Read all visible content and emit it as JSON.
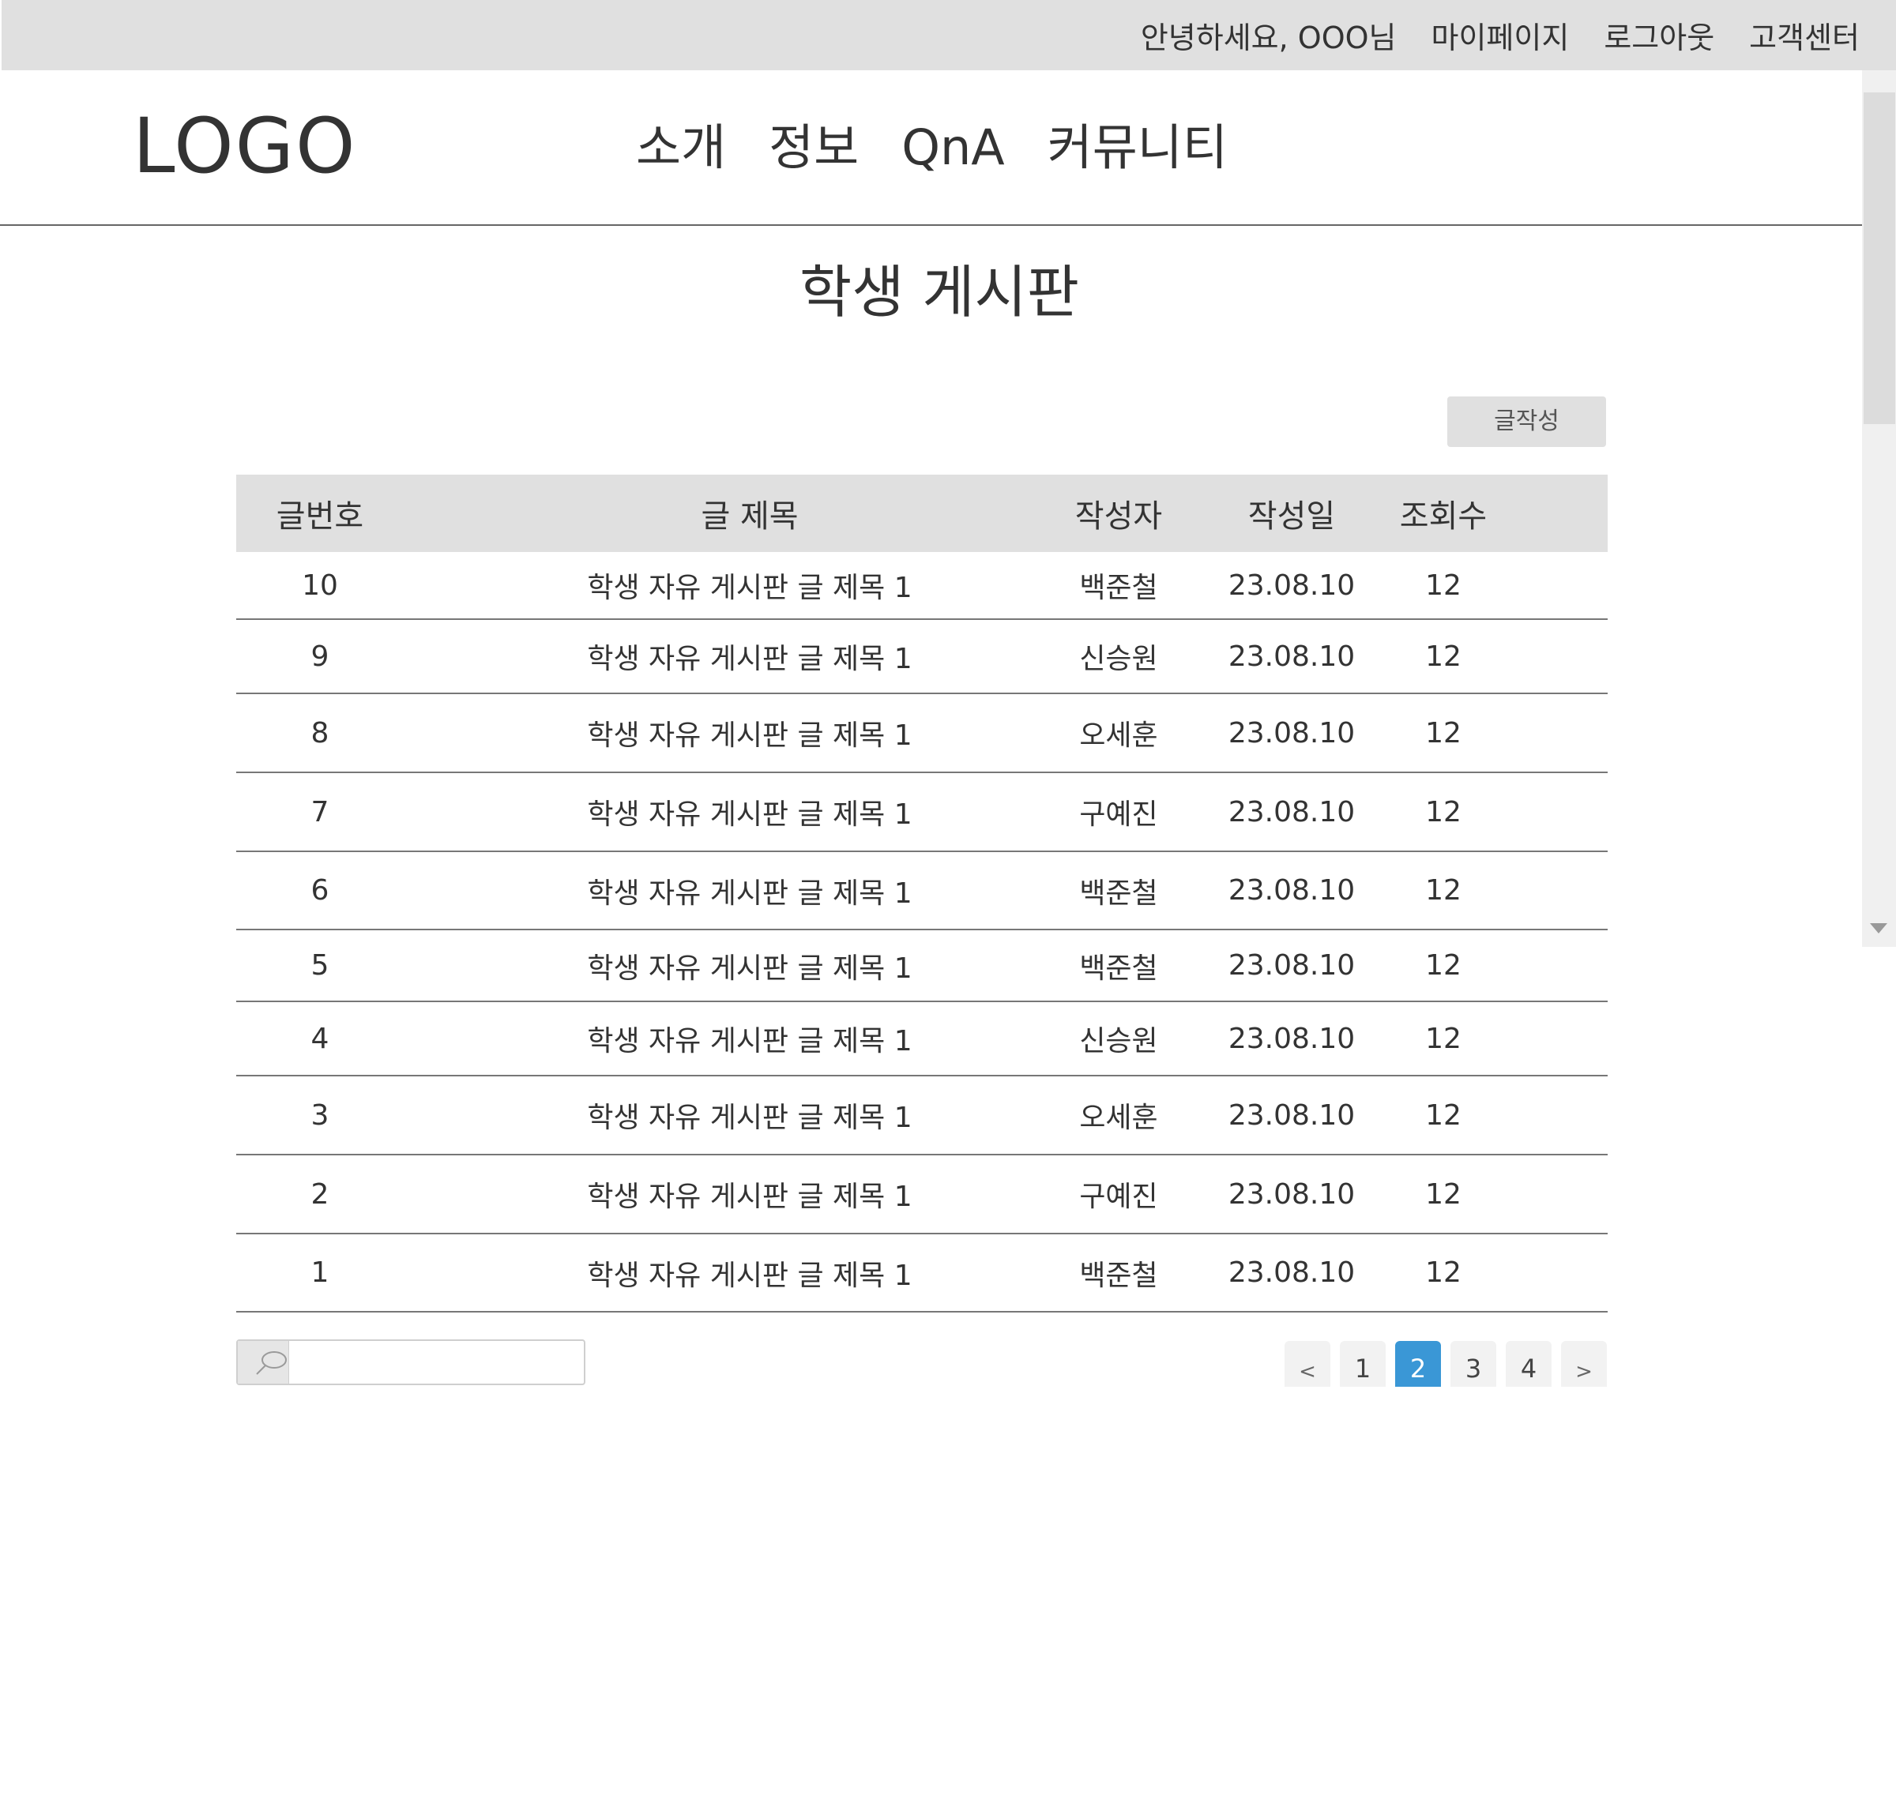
{
  "topbar": {
    "greeting": "안녕하세요, OOO님",
    "mypage": "마이페이지",
    "logout": "로그아웃",
    "support": "고객센터"
  },
  "header": {
    "logo": "LOGO",
    "nav": [
      "소개",
      "정보",
      "QnA",
      "커뮤니티"
    ]
  },
  "page": {
    "title": "학생 게시판",
    "write_button": "글작성"
  },
  "table": {
    "headers": {
      "no": "글번호",
      "title": "글 제목",
      "author": "작성자",
      "date": "작성일",
      "views": "조회수"
    },
    "rows": [
      {
        "no": "10",
        "title": "학생 자유 게시판 글 제목 1",
        "author": "백준철",
        "date": "23.08.10",
        "views": "12"
      },
      {
        "no": "9",
        "title": "학생 자유 게시판 글 제목 1",
        "author": "신승원",
        "date": "23.08.10",
        "views": "12"
      },
      {
        "no": "8",
        "title": "학생 자유 게시판 글 제목 1",
        "author": "오세훈",
        "date": "23.08.10",
        "views": "12"
      },
      {
        "no": "7",
        "title": "학생 자유 게시판 글 제목 1",
        "author": "구예진",
        "date": "23.08.10",
        "views": "12"
      },
      {
        "no": "6",
        "title": "학생 자유 게시판 글 제목 1",
        "author": "백준철",
        "date": "23.08.10",
        "views": "12"
      },
      {
        "no": "5",
        "title": "학생 자유 게시판 글 제목 1",
        "author": "백준철",
        "date": "23.08.10",
        "views": "12"
      },
      {
        "no": "4",
        "title": "학생 자유 게시판 글 제목 1",
        "author": "신승원",
        "date": "23.08.10",
        "views": "12"
      },
      {
        "no": "3",
        "title": "학생 자유 게시판 글 제목 1",
        "author": "오세훈",
        "date": "23.08.10",
        "views": "12"
      },
      {
        "no": "2",
        "title": "학생 자유 게시판 글 제목 1",
        "author": "구예진",
        "date": "23.08.10",
        "views": "12"
      },
      {
        "no": "1",
        "title": "학생 자유 게시판 글 제목 1",
        "author": "백준철",
        "date": "23.08.10",
        "views": "12"
      }
    ]
  },
  "search": {
    "icon": "search-icon",
    "value": "",
    "placeholder": ""
  },
  "pagination": {
    "prev": "<",
    "next": ">",
    "pages": [
      "1",
      "2",
      "3",
      "4"
    ],
    "current": "2",
    "active_color": "#3a97d6"
  }
}
